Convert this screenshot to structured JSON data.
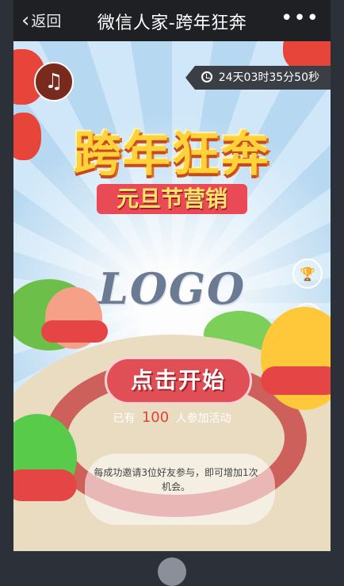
{
  "nav": {
    "back_label": "返回",
    "title": "微信人家-跨年狂奔",
    "more_label": "•••"
  },
  "timer": {
    "text": "24天03时35分50秒"
  },
  "banner": {
    "title": "跨年狂奔",
    "subtitle": "元旦节营销"
  },
  "logo_text": "LOGO",
  "start_button": "点击开始",
  "participants": {
    "prefix": "已有",
    "count": "100",
    "suffix": "人参加活动"
  },
  "tip": "每成功邀请3位好友参与，即可增加1次机会。",
  "icons": {
    "music": "music-note-icon",
    "trophy": "trophy-icon",
    "home": "house-icon"
  },
  "colors": {
    "accent": "#e04f55",
    "count": "#e0433d",
    "nav_bg": "#1f2024"
  }
}
